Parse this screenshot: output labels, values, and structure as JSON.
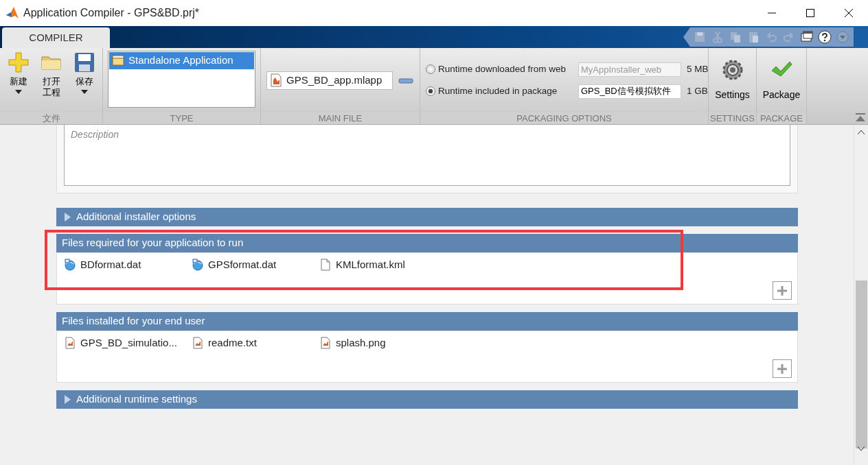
{
  "window": {
    "title": "Application Compiler - GPS&BD.prj*"
  },
  "ribbon": {
    "tabs": [
      {
        "label": "COMPILER",
        "selected": true
      }
    ],
    "file_group": {
      "label": "文件",
      "buttons": [
        {
          "kind": "new",
          "label": "新建",
          "dropdown": true
        },
        {
          "kind": "open",
          "label": "打开工程"
        },
        {
          "kind": "save",
          "label": "保存",
          "dropdown": true
        }
      ]
    },
    "type_group": {
      "label": "TYPE",
      "items": [
        {
          "label": "Standalone Application",
          "selected": true
        }
      ]
    },
    "main_file_group": {
      "label": "MAIN FILE",
      "file": "GPS_BD_app.mlapp"
    },
    "packaging_group": {
      "label": "PACKAGING OPTIONS",
      "options": [
        {
          "label": "Runtime downloaded from web",
          "selected": false,
          "value": "MyAppInstaller_web",
          "disabled": true,
          "size": "5 MB"
        },
        {
          "label": "Runtime included in package",
          "selected": true,
          "value": "GPS_BD信号模拟软件",
          "disabled": false,
          "size": "1 GB"
        }
      ]
    },
    "settings_group": {
      "label": "SETTINGS",
      "button": "Settings"
    },
    "package_group": {
      "label": "PACKAGE",
      "button": "Package"
    }
  },
  "description": {
    "placeholder": "Description"
  },
  "sections": [
    {
      "kind": "collapsible",
      "title": "Additional installer options",
      "expanded": false
    },
    {
      "kind": "file_list",
      "title": "Files required for your application to run",
      "highlighted": true,
      "files": [
        {
          "kind": "data",
          "name": "BDformat.dat"
        },
        {
          "kind": "data",
          "name": "GPSformat.dat"
        },
        {
          "kind": "blank",
          "name": "KMLformat.kml"
        }
      ]
    },
    {
      "kind": "file_list",
      "title": "Files installed for your end user",
      "files": [
        {
          "kind": "matlab",
          "name": "GPS_BD_simulatio..."
        },
        {
          "kind": "matlab",
          "name": "readme.txt"
        },
        {
          "kind": "matlab",
          "name": "splash.png"
        }
      ]
    },
    {
      "kind": "collapsible",
      "title": "Additional runtime settings",
      "expanded": false
    }
  ]
}
